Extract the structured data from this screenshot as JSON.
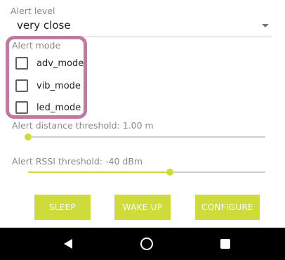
{
  "alert_level": {
    "label": "Alert level",
    "value": "very close"
  },
  "alert_mode": {
    "label": "Alert mode",
    "options": [
      {
        "label": "adv_mode",
        "checked": false
      },
      {
        "label": "vib_mode",
        "checked": false
      },
      {
        "label": "led_mode",
        "checked": false
      }
    ]
  },
  "distance_threshold": {
    "label": "Alert distance threshold: 1.00 m",
    "fraction": 0.0
  },
  "rssi_threshold": {
    "label": "Alert RSSI threshold: -40 dBm",
    "fraction": 0.6
  },
  "buttons": {
    "sleep": "SLEEP",
    "wake_up": "WAKE UP",
    "configure": "CONFIGURE"
  },
  "colors": {
    "accent": "#cddc39",
    "highlight": "#c07aa2"
  },
  "icons": {
    "dropdown": "chevron-down-icon",
    "back": "back-triangle-icon",
    "home": "home-circle-icon",
    "recents": "recents-square-icon"
  }
}
